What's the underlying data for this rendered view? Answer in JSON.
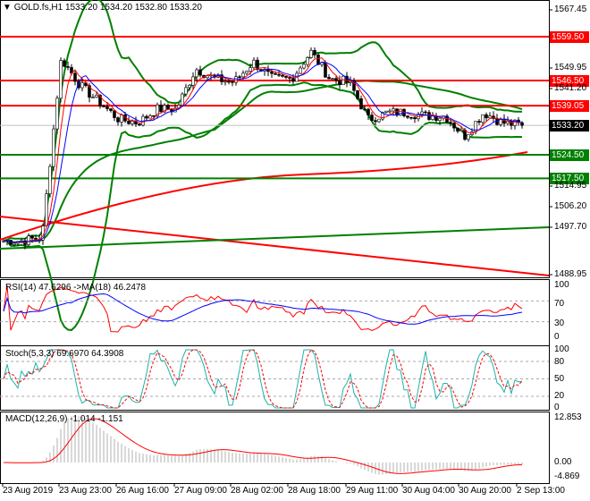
{
  "header": {
    "symbol": "GOLD.fs,H1",
    "open": "1533.20",
    "high": "1534.20",
    "low": "1532.80",
    "close": "1533.20"
  },
  "price_axis": [
    "1567.45",
    "1549.95",
    "1541.20",
    "1514.95",
    "1506.20",
    "1497.70",
    "1488.95"
  ],
  "levels": [
    {
      "price": "1559.50",
      "color": "#ff0000"
    },
    {
      "price": "1546.50",
      "color": "#ff0000"
    },
    {
      "price": "1539.05",
      "color": "#ff0000"
    },
    {
      "price": "1533.20",
      "color": "#000000"
    },
    {
      "price": "1524.50",
      "color": "#008000"
    },
    {
      "price": "1517.50",
      "color": "#008000"
    }
  ],
  "rsi": {
    "label": "RSI(14) 47.6296 ->MA(18) 46.2478",
    "axis": [
      "100",
      "70",
      "30",
      "0"
    ]
  },
  "stoch": {
    "label": "Stoch(5,3,3) 69.6970 64.3908",
    "axis": [
      "100",
      "80",
      "50",
      "20",
      "0"
    ]
  },
  "macd": {
    "label": "MACD(12,26,9) -1.014 -1.151",
    "axis": [
      "12.853",
      "0.00",
      "-4.869"
    ]
  },
  "time_axis": [
    "23 Aug 2019",
    "23 Aug 23:00",
    "26 Aug 16:00",
    "27 Aug 09:00",
    "28 Aug 02:00",
    "28 Aug 18:00",
    "29 Aug 11:00",
    "30 Aug 04:00",
    "30 Aug 20:00",
    "2 Sep 13:00"
  ],
  "chart_data": {
    "type": "candlestick",
    "symbol": "GOLD.fs",
    "timeframe": "H1",
    "ylim": [
      1488.95,
      1567.45
    ],
    "anchor_closes": [
      1499,
      1499,
      1500,
      1553,
      1545,
      1540,
      1535,
      1534,
      1538,
      1538,
      1550,
      1547,
      1546,
      1552,
      1547,
      1547,
      1555,
      1547,
      1546,
      1535,
      1537,
      1537,
      1536,
      1536,
      1530,
      1537,
      1534,
      1533.2
    ]
  }
}
